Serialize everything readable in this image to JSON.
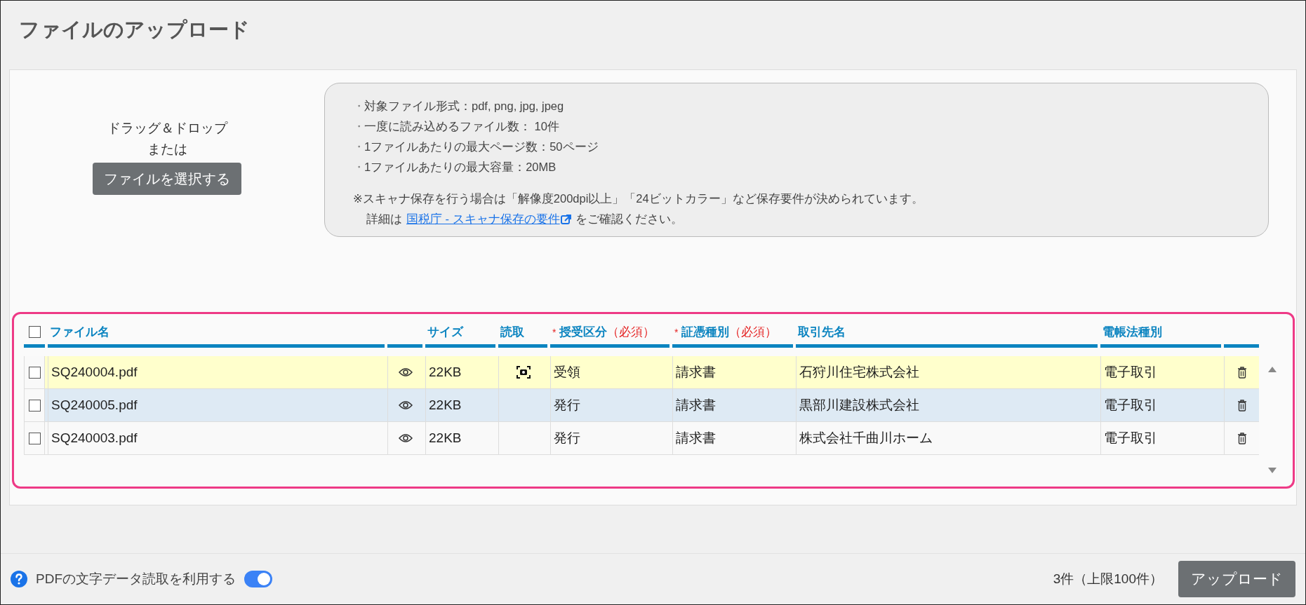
{
  "title": "ファイルのアップロード",
  "dropzone": {
    "line1": "ドラッグ＆ドロップ",
    "line2": "または",
    "button": "ファイルを選択する"
  },
  "info": {
    "items": [
      "対象ファイル形式：pdf, png, jpg, jpeg",
      "一度に読み込めるファイル数： 10件",
      "1ファイルあたりの最大ページ数：50ページ",
      "1ファイルあたりの最大容量：20MB"
    ],
    "bullet": "・",
    "note": "※スキャナ保存を行う場合は「解像度200dpi以上」「24ビットカラー」など保存要件が決められています。",
    "detail_before": "詳細は",
    "link": "国税庁 - スキャナ保存の要件",
    "detail_after": "をご確認ください。"
  },
  "table": {
    "header_checked": false,
    "columns": [
      {
        "label": "ファイル名"
      },
      {},
      {
        "label": "サイズ"
      },
      {
        "label": "読取"
      },
      {
        "label": "授受区分",
        "marker": "*",
        "note": "（必須）"
      },
      {
        "label": "証憑種別",
        "marker": "*",
        "note": "（必須）"
      },
      {
        "label": "取引先名"
      },
      {
        "label": "電帳法種別"
      },
      {}
    ],
    "rows": [
      {
        "checked": false,
        "selected": true,
        "hovered": false,
        "file": "SQ240004.pdf",
        "size": "22KB",
        "scanned": true,
        "direction": "受領",
        "doc_type": "請求書",
        "partner": "石狩川住宅株式会社",
        "law_type": "電子取引"
      },
      {
        "checked": false,
        "selected": false,
        "hovered": true,
        "file": "SQ240005.pdf",
        "size": "22KB",
        "scanned": false,
        "direction": "発行",
        "doc_type": "請求書",
        "partner": "黒部川建設株式会社",
        "law_type": "電子取引"
      },
      {
        "checked": false,
        "selected": false,
        "hovered": false,
        "file": "SQ240003.pdf",
        "size": "22KB",
        "scanned": false,
        "direction": "発行",
        "doc_type": "請求書",
        "partner": "株式会社千曲川ホーム",
        "law_type": "電子取引"
      }
    ]
  },
  "footer": {
    "toggle_label": "PDFの文字データ読取を利用する",
    "toggle_on": true,
    "count": "3件（上限100件）",
    "upload_button": "アップロード"
  }
}
